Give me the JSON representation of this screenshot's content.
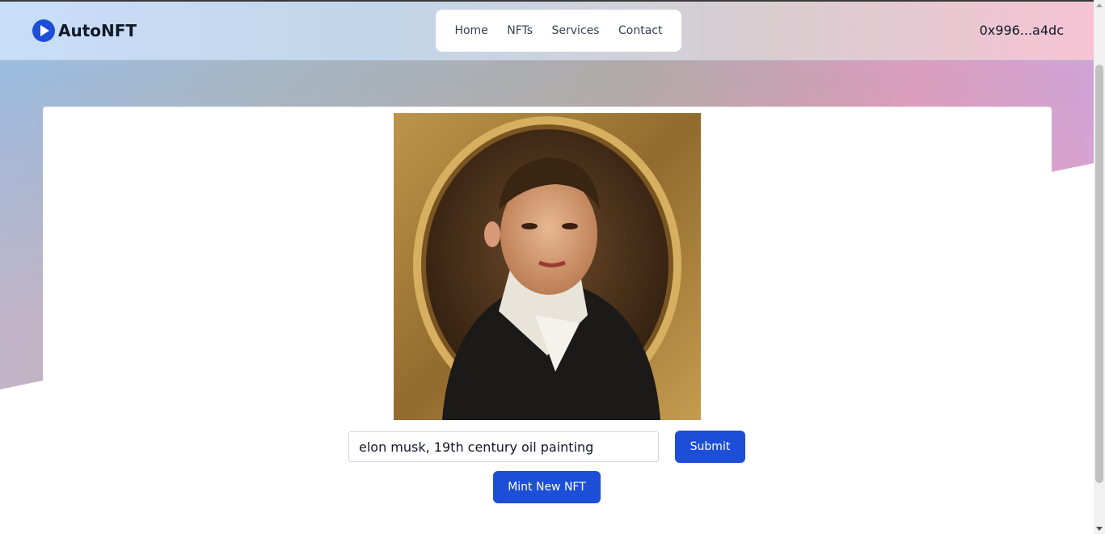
{
  "brand": {
    "name": "AutoNFT",
    "logo_icon": "play-icon"
  },
  "nav": {
    "links": [
      "Home",
      "NFTs",
      "Services",
      "Contact"
    ]
  },
  "wallet": {
    "address": "0x996...a4dc"
  },
  "generator": {
    "prompt_value": "elon musk, 19th century oil painting",
    "submit_label": "Submit",
    "mint_label": "Mint New NFT"
  },
  "colors": {
    "primary": "#1d4ed8",
    "nav_bg": "#ffffff",
    "card_bg": "#ffffff"
  }
}
